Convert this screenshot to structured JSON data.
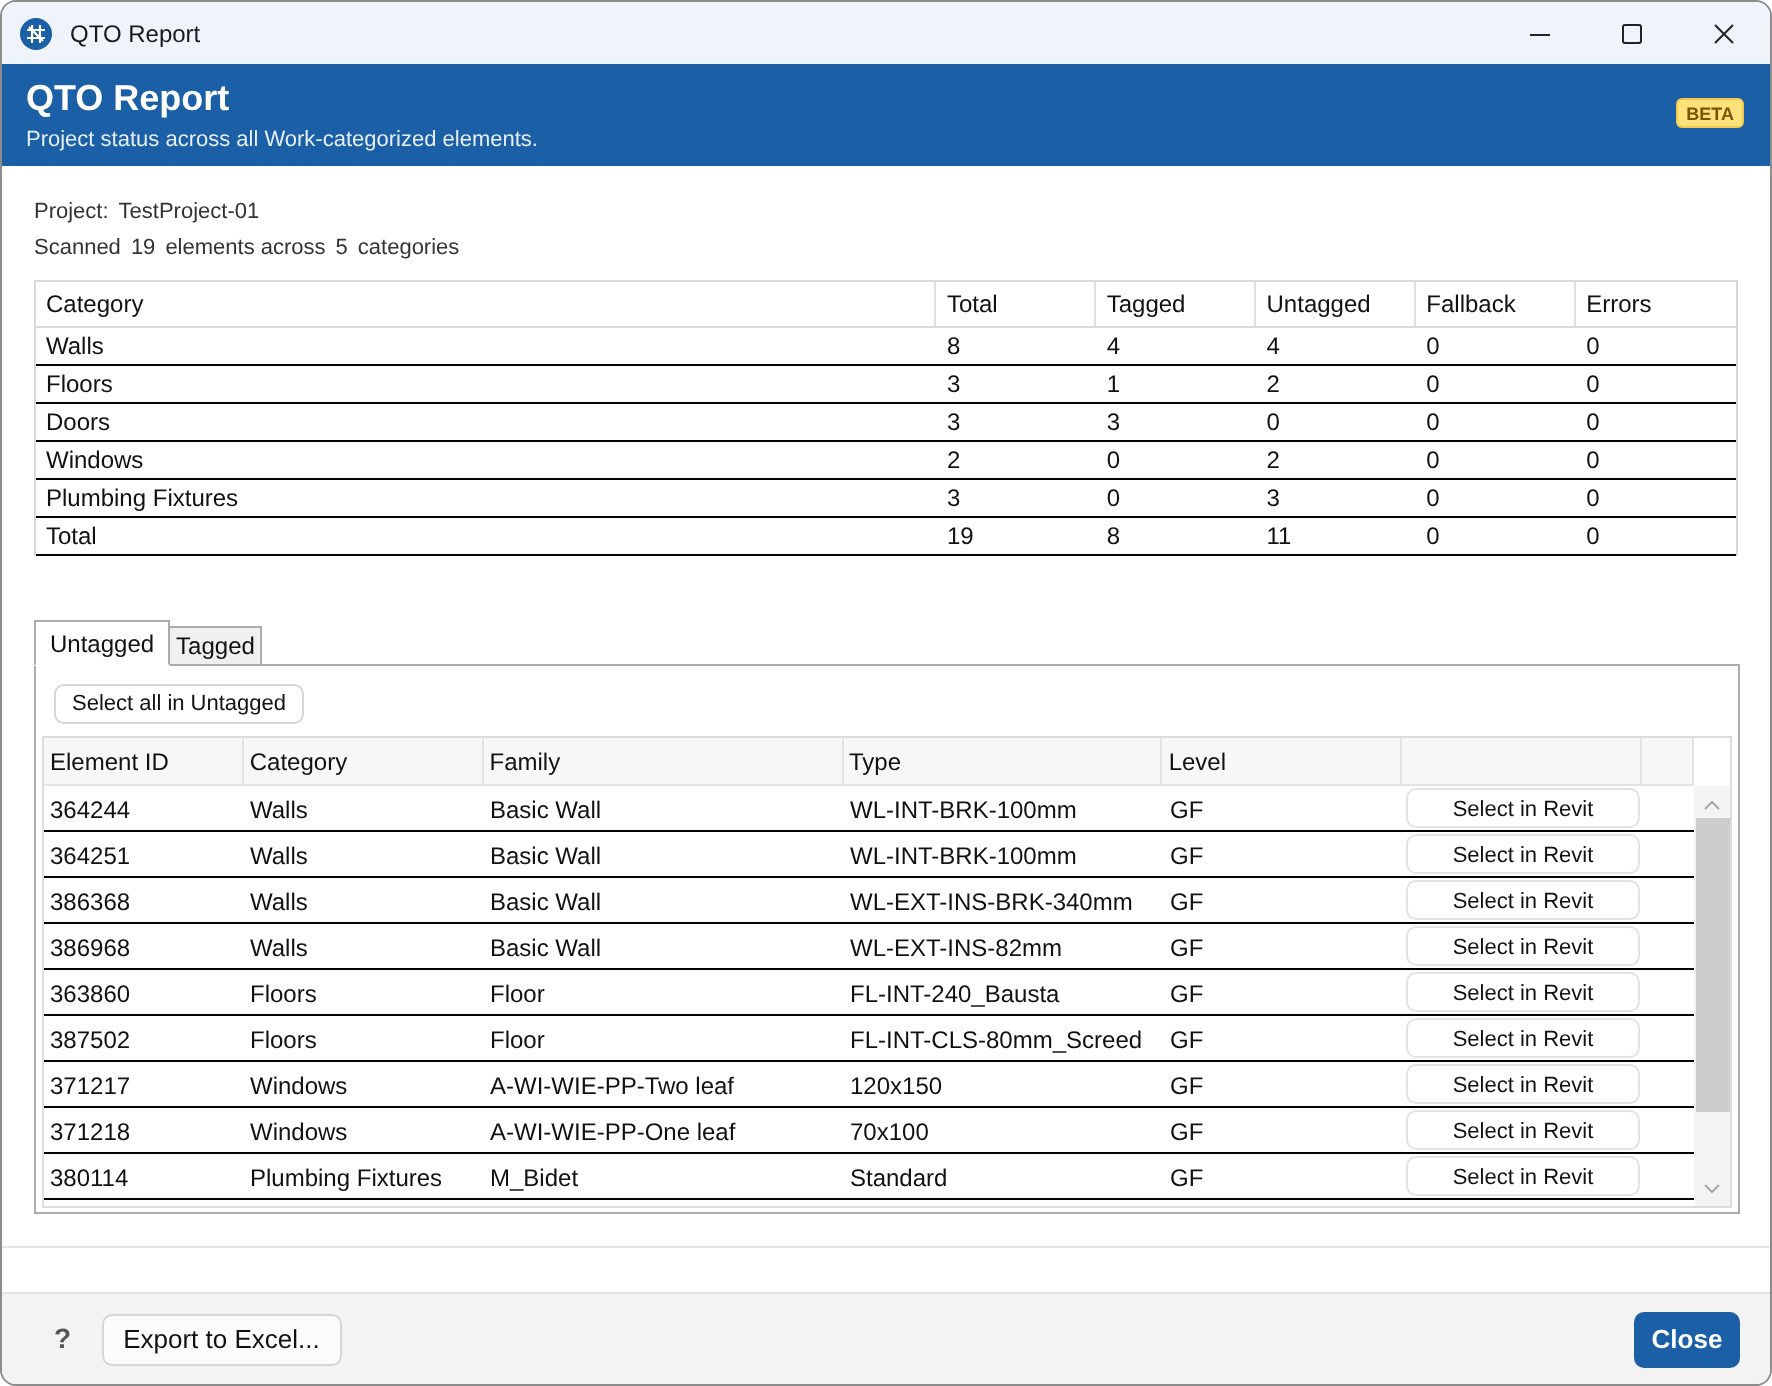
{
  "window": {
    "title": "QTO Report"
  },
  "header": {
    "title": "QTO Report",
    "subtitle": "Project status across all Work-categorized elements.",
    "badge": "BETA"
  },
  "project": {
    "label": "Project:",
    "name": "TestProject-01"
  },
  "scan_summary": [
    "Scanned",
    "19",
    "elements across",
    "5",
    "categories"
  ],
  "summary_table": {
    "columns": [
      "Category",
      "Total",
      "Tagged",
      "Untagged",
      "Fallback",
      "Errors"
    ],
    "rows": [
      [
        "Walls",
        "8",
        "4",
        "4",
        "0",
        "0"
      ],
      [
        "Floors",
        "3",
        "1",
        "2",
        "0",
        "0"
      ],
      [
        "Doors",
        "3",
        "3",
        "0",
        "0",
        "0"
      ],
      [
        "Windows",
        "2",
        "0",
        "2",
        "0",
        "0"
      ],
      [
        "Plumbing Fixtures",
        "3",
        "0",
        "3",
        "0",
        "0"
      ],
      [
        "Total",
        "19",
        "8",
        "11",
        "0",
        "0"
      ]
    ]
  },
  "tabs": [
    {
      "label": "Untagged",
      "selected": true
    },
    {
      "label": "Tagged",
      "selected": false
    }
  ],
  "select_all_button": "Select all in Untagged",
  "elements_table": {
    "columns": [
      "Element ID",
      "Category",
      "Family",
      "Type",
      "Level"
    ],
    "rows": [
      {
        "cells": [
          "364244",
          "Walls",
          "Basic Wall",
          "WL-INT-BRK-100mm",
          "GF"
        ],
        "action": "Select in Revit"
      },
      {
        "cells": [
          "364251",
          "Walls",
          "Basic Wall",
          "WL-INT-BRK-100mm",
          "GF"
        ],
        "action": "Select in Revit"
      },
      {
        "cells": [
          "386368",
          "Walls",
          "Basic Wall",
          "WL-EXT-INS-BRK-340mm",
          "GF"
        ],
        "action": "Select in Revit"
      },
      {
        "cells": [
          "386968",
          "Walls",
          "Basic Wall",
          "WL-EXT-INS-82mm",
          "GF"
        ],
        "action": "Select in Revit"
      },
      {
        "cells": [
          "363860",
          "Floors",
          "Floor",
          "FL-INT-240_Bausta",
          "GF"
        ],
        "action": "Select in Revit"
      },
      {
        "cells": [
          "387502",
          "Floors",
          "Floor",
          "FL-INT-CLS-80mm_Screed",
          "GF"
        ],
        "action": "Select in Revit"
      },
      {
        "cells": [
          "371217",
          "Windows",
          "A-WI-WIE-PP-Two leaf",
          "120x150",
          "GF"
        ],
        "action": "Select in Revit"
      },
      {
        "cells": [
          "371218",
          "Windows",
          "A-WI-WIE-PP-One leaf",
          "70x100",
          "GF"
        ],
        "action": "Select in Revit"
      },
      {
        "cells": [
          "380114",
          "Plumbing Fixtures",
          "M_Bidet",
          "Standard",
          "GF"
        ],
        "action": "Select in Revit"
      }
    ]
  },
  "footer": {
    "help": "?",
    "export_button": "Export to Excel...",
    "close_button": "Close"
  }
}
